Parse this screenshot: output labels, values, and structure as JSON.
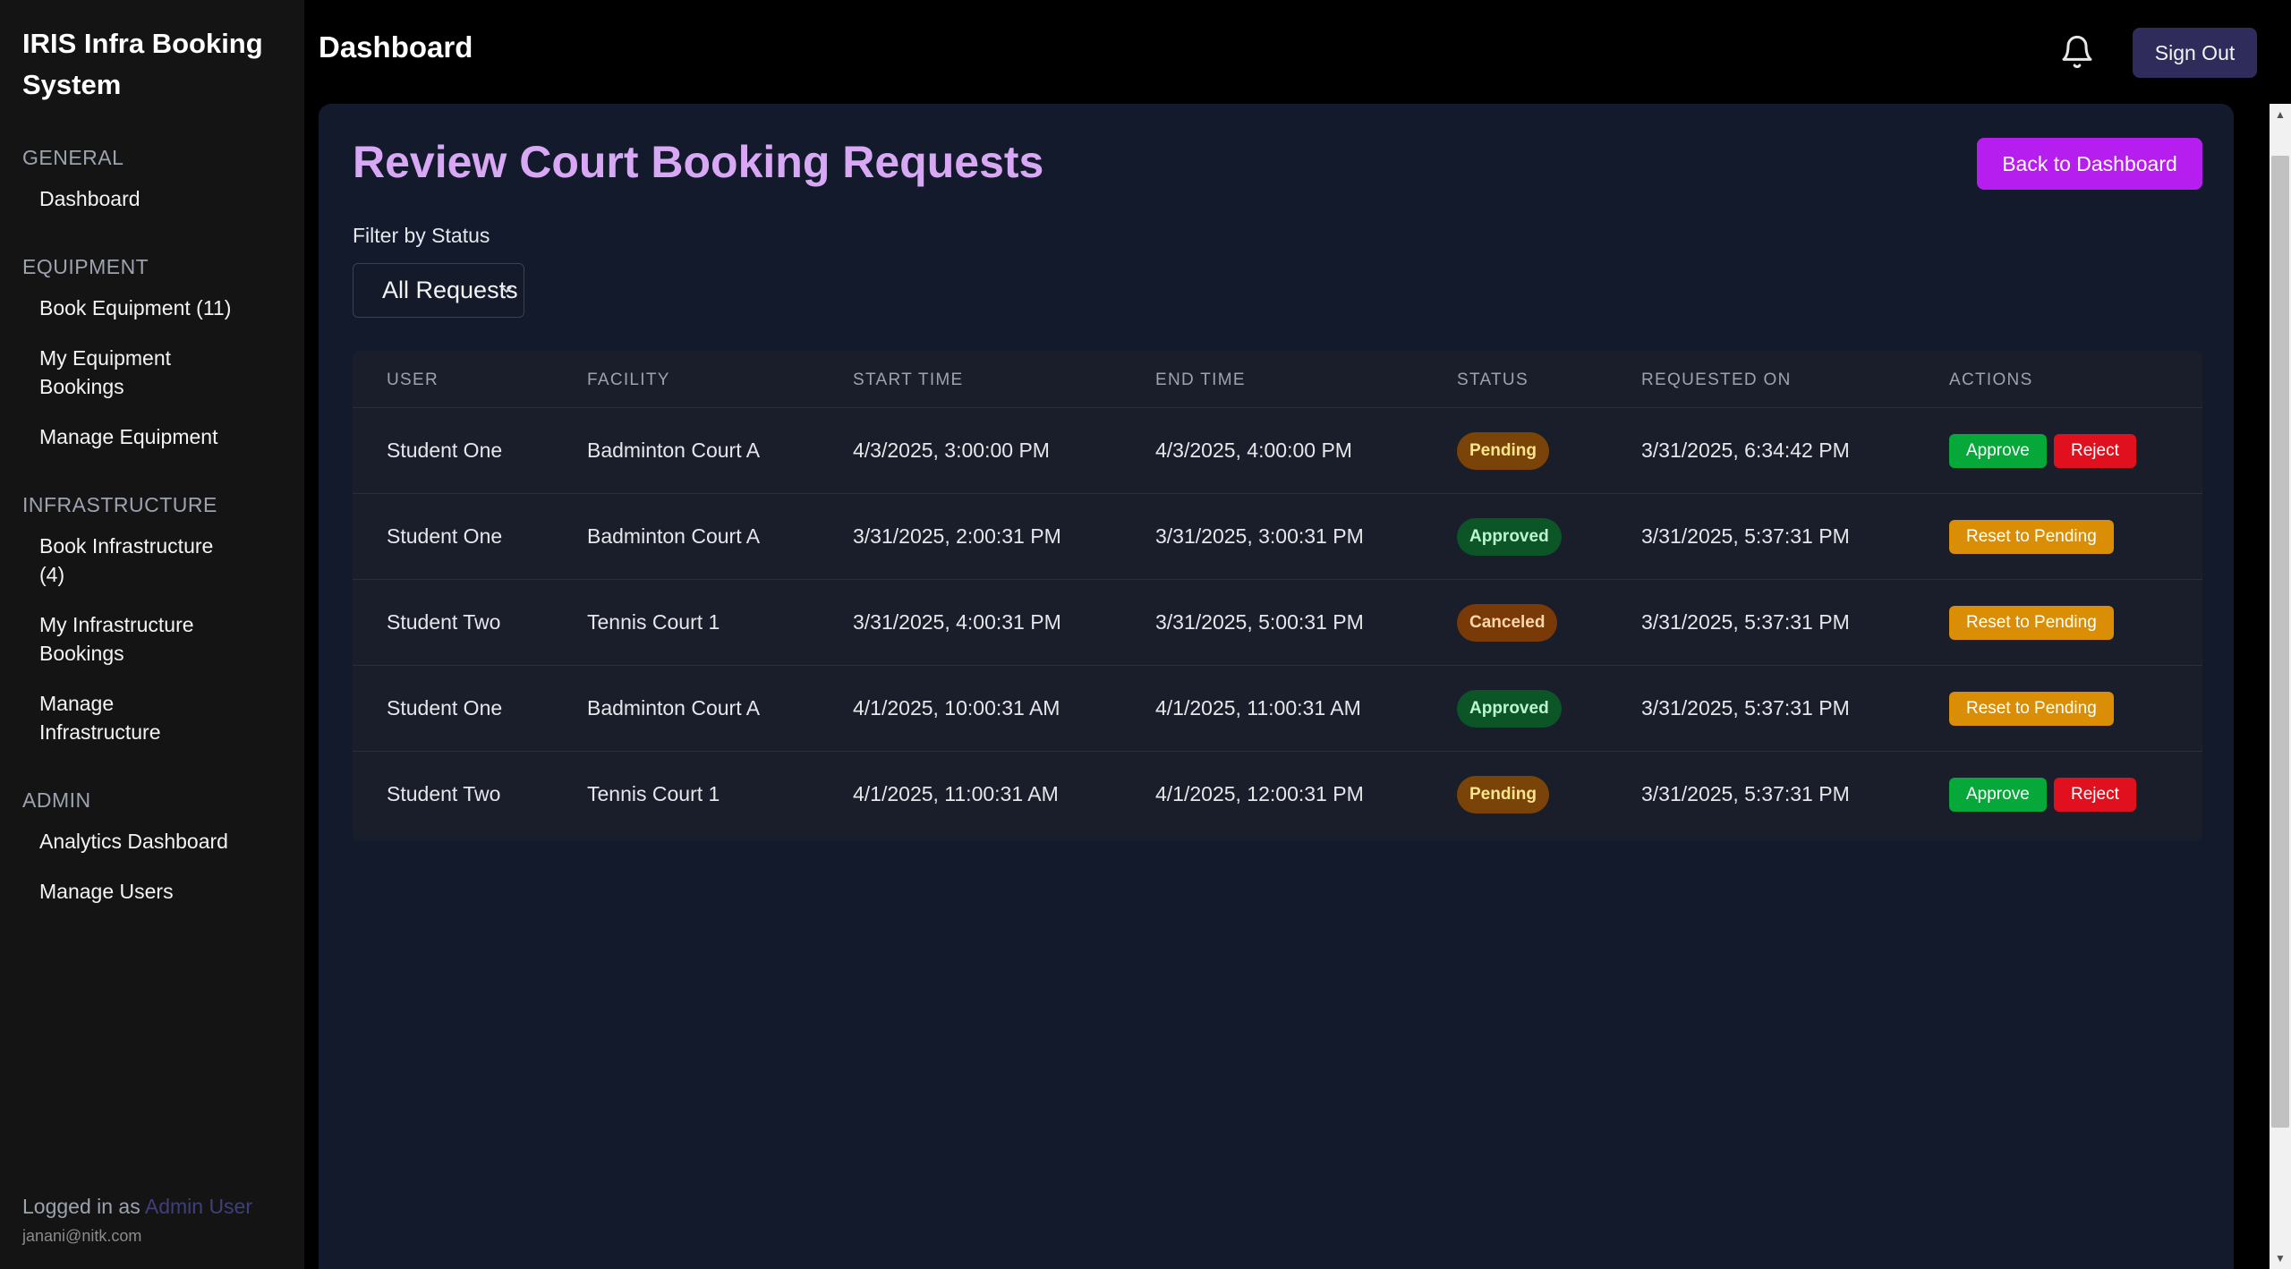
{
  "sidebar": {
    "brand": "IRIS Infra Booking System",
    "sections": [
      {
        "heading": "GENERAL",
        "items": [
          "Dashboard"
        ]
      },
      {
        "heading": "EQUIPMENT",
        "items": [
          "Book Equipment (11)",
          "My Equipment Bookings",
          "Manage Equipment"
        ]
      },
      {
        "heading": "INFRASTRUCTURE",
        "items": [
          "Book Infrastructure (4)",
          "My Infrastructure Bookings",
          "Manage Infrastructure"
        ]
      },
      {
        "heading": "ADMIN",
        "items": [
          "Analytics Dashboard",
          "Manage Users"
        ]
      }
    ],
    "footer": {
      "logged_in_prefix": "Logged in as",
      "user_name": "Admin User",
      "email": "janani@nitk.com"
    }
  },
  "topbar": {
    "title": "Dashboard",
    "bell_icon": "bell-icon",
    "sign_out": "Sign Out"
  },
  "main": {
    "title": "Review Court Booking Requests",
    "back_button": "Back to Dashboard",
    "filter_label": "Filter by Status",
    "filter_value": "All Requests",
    "columns": [
      "USER",
      "FACILITY",
      "START TIME",
      "END TIME",
      "STATUS",
      "REQUESTED ON",
      "ACTIONS"
    ],
    "rows": [
      {
        "user": "Student One",
        "facility": "Badminton Court A",
        "start": "4/3/2025, 3:00:00 PM",
        "end": "4/3/2025, 4:00:00 PM",
        "status": "Pending",
        "requested": "3/31/2025, 6:34:42 PM",
        "actions": [
          "Approve",
          "Reject"
        ]
      },
      {
        "user": "Student One",
        "facility": "Badminton Court A",
        "start": "3/31/2025, 2:00:31 PM",
        "end": "3/31/2025, 3:00:31 PM",
        "status": "Approved",
        "requested": "3/31/2025, 5:37:31 PM",
        "actions": [
          "Reset to Pending"
        ]
      },
      {
        "user": "Student Two",
        "facility": "Tennis Court 1",
        "start": "3/31/2025, 4:00:31 PM",
        "end": "3/31/2025, 5:00:31 PM",
        "status": "Canceled",
        "requested": "3/31/2025, 5:37:31 PM",
        "actions": [
          "Reset to Pending"
        ]
      },
      {
        "user": "Student One",
        "facility": "Badminton Court A",
        "start": "4/1/2025, 10:00:31 AM",
        "end": "4/1/2025, 11:00:31 AM",
        "status": "Approved",
        "requested": "3/31/2025, 5:37:31 PM",
        "actions": [
          "Reset to Pending"
        ]
      },
      {
        "user": "Student Two",
        "facility": "Tennis Court 1",
        "start": "4/1/2025, 11:00:31 AM",
        "end": "4/1/2025, 12:00:31 PM",
        "status": "Pending",
        "requested": "3/31/2025, 5:37:31 PM",
        "actions": [
          "Approve",
          "Reject"
        ]
      }
    ]
  },
  "colors": {
    "accent_title": "#d8a8f5",
    "back_button": "#b61ef0",
    "approve": "#07a83a",
    "reject": "#e0101e",
    "reset": "#d98e05",
    "pending_badge": "#7a4308",
    "approved_badge": "#0c5527",
    "canceled_badge": "#7a3a08"
  }
}
